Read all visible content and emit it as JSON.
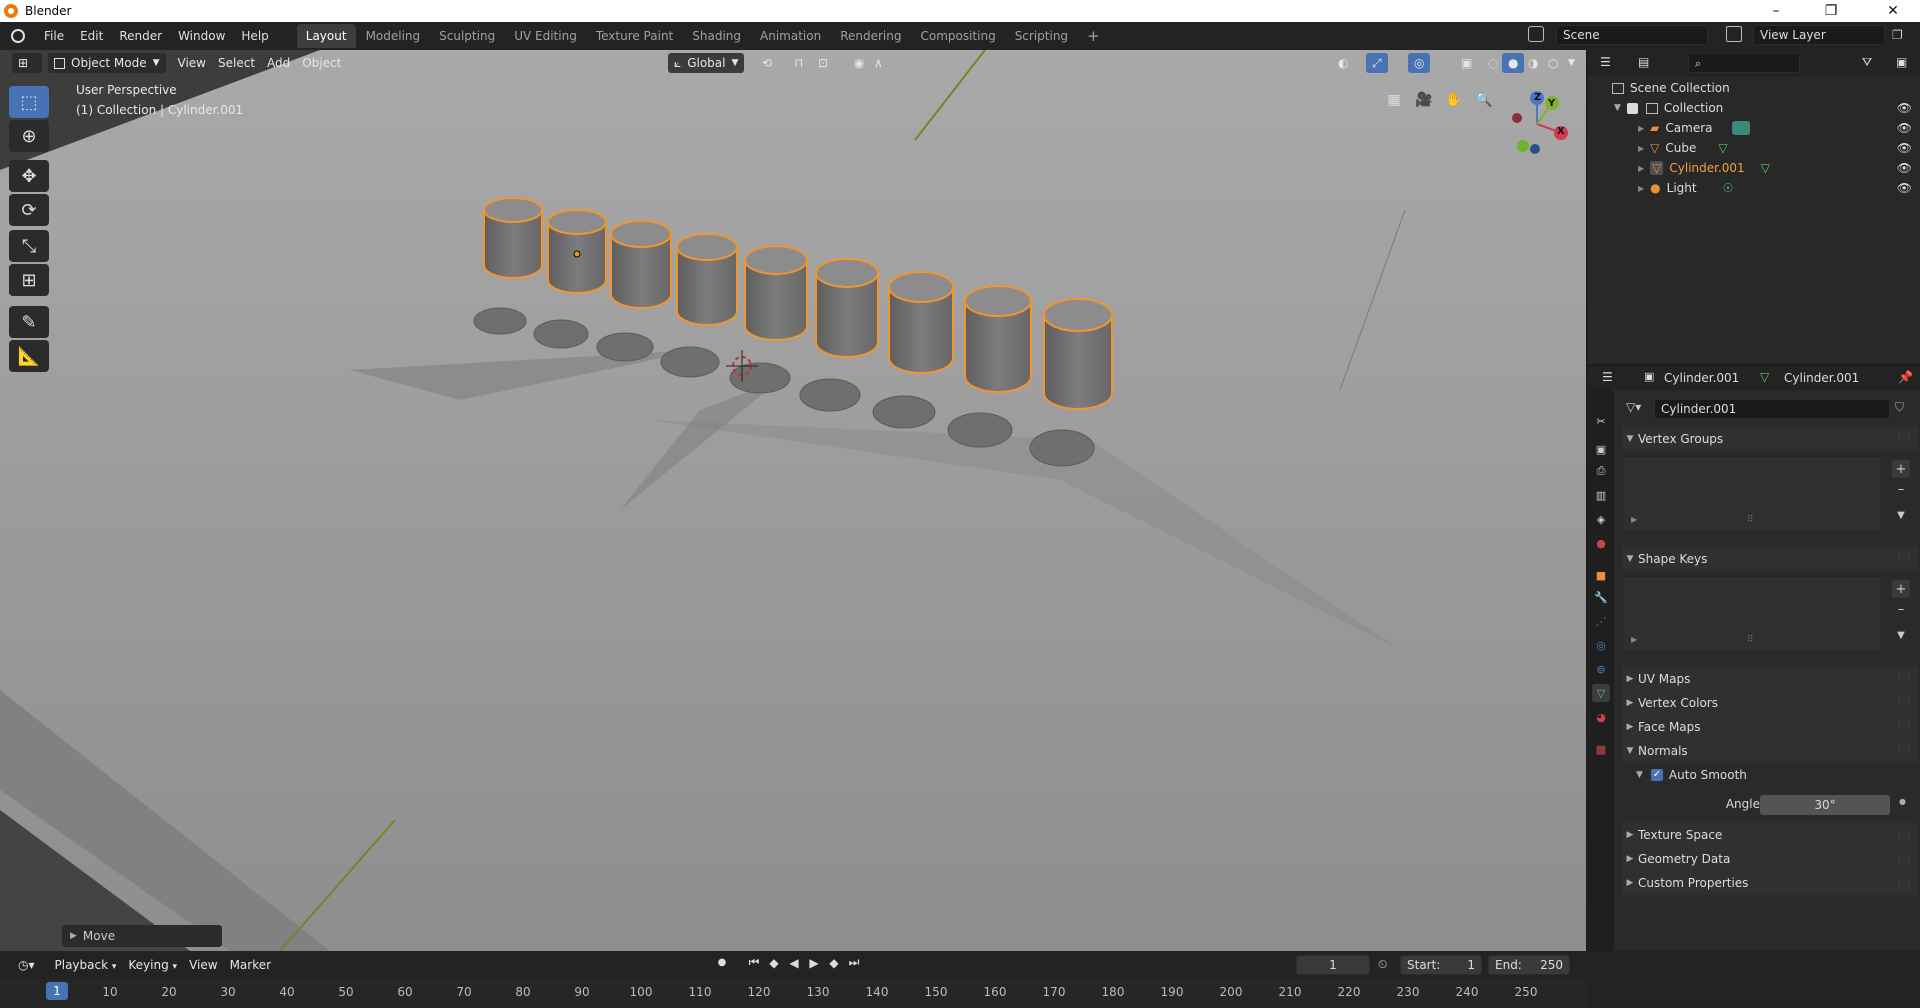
{
  "window": {
    "title": "Blender",
    "minimize": "–",
    "restore": "❐",
    "close": "✕"
  },
  "menus": [
    "File",
    "Edit",
    "Render",
    "Window",
    "Help"
  ],
  "workspaces": [
    "Layout",
    "Modeling",
    "Sculpting",
    "UV Editing",
    "Texture Paint",
    "Shading",
    "Animation",
    "Rendering",
    "Compositing",
    "Scripting"
  ],
  "workspace_add": "+",
  "scene": {
    "name": "Scene",
    "view_layer": "View Layer"
  },
  "viewport": {
    "mode": "Object Mode",
    "menus": [
      "View",
      "Select",
      "Add",
      "Object"
    ],
    "orientation": "Global",
    "overlay_title": "User Perspective",
    "overlay_sub": "(1) Collection | Cylinder.001",
    "last_op": "Move",
    "gizmo": {
      "x": "X",
      "y": "Y",
      "z": "Z"
    }
  },
  "outliner": {
    "root": "Scene Collection",
    "collection": "Collection",
    "items": [
      {
        "name": "Camera",
        "icon": "camera-icon",
        "color": "#e8913a",
        "selected": false
      },
      {
        "name": "Cube",
        "icon": "mesh-icon",
        "color": "#e8913a",
        "selected": false
      },
      {
        "name": "Cylinder.001",
        "icon": "mesh-icon",
        "color": "#e8913a",
        "selected": true
      },
      {
        "name": "Light",
        "icon": "light-icon",
        "color": "#e8913a",
        "selected": false
      }
    ]
  },
  "properties": {
    "object_name": "Cylinder.001",
    "mesh_name": "Cylinder.001",
    "datablock": "Cylinder.001",
    "panels": {
      "vertex_groups": "Vertex Groups",
      "shape_keys": "Shape Keys",
      "uv_maps": "UV Maps",
      "vertex_colors": "Vertex Colors",
      "face_maps": "Face Maps",
      "normals": "Normals",
      "auto_smooth": "Auto Smooth",
      "angle_label": "Angle",
      "angle_value": "30°",
      "texture_space": "Texture Space",
      "geometry_data": "Geometry Data",
      "custom_properties": "Custom Properties"
    }
  },
  "timeline": {
    "menus": [
      "Playback",
      "Keying",
      "View",
      "Marker"
    ],
    "current_frame": "1",
    "start_label": "Start:",
    "start": "1",
    "end_label": "End:",
    "end": "250",
    "ruler": [
      "10",
      "20",
      "30",
      "40",
      "50",
      "60",
      "70",
      "80",
      "90",
      "100",
      "110",
      "120",
      "130",
      "140",
      "150",
      "160",
      "170",
      "180",
      "190",
      "200",
      "210",
      "220",
      "230",
      "240",
      "250"
    ],
    "ruler_current": "1"
  },
  "colors": {
    "accent": "#4772b3",
    "selection": "#f0962e",
    "header": "#232323"
  }
}
